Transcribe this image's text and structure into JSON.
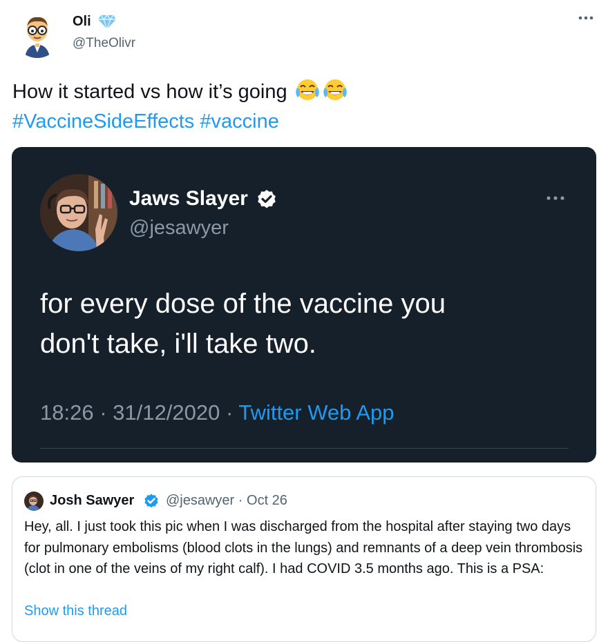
{
  "author": {
    "name": "Oli",
    "handle": "@TheOlivr",
    "badge": "diamond-emoji-icon",
    "avatar": "nerd-face-emoji-avatar"
  },
  "tweet": {
    "text": "How it started vs how it’s going",
    "emojis": [
      "face-with-tears-of-joy-icon",
      "face-with-tears-of-joy-icon"
    ],
    "hashtags": [
      "#VaccineSideEffects",
      "#vaccine"
    ]
  },
  "media": {
    "name": "Jaws Slayer",
    "handle": "@jesawyer",
    "text_line1": "for every dose of the vaccine you",
    "text_line2": "don't take, i'll take two.",
    "time": "18:26",
    "date": "31/12/2020",
    "sep": "·",
    "app": "Twitter Web App",
    "theme_bg": "#15202b"
  },
  "quote": {
    "name": "Josh Sawyer",
    "handle": "@jesawyer",
    "sep": "·",
    "date": "Oct 26",
    "text": "Hey, all. I just took this pic when I was discharged from the hospital after staying two days for pulmonary embolisms (blood clots in the lungs) and remnants of a deep vein thrombosis (clot in one of the veins of my right calf). I had COVID 3.5 months ago. This is a PSA:",
    "show_thread": "Show this thread"
  },
  "colors": {
    "accent": "#1d9bf0",
    "text": "#0f1419",
    "muted": "#536471"
  }
}
